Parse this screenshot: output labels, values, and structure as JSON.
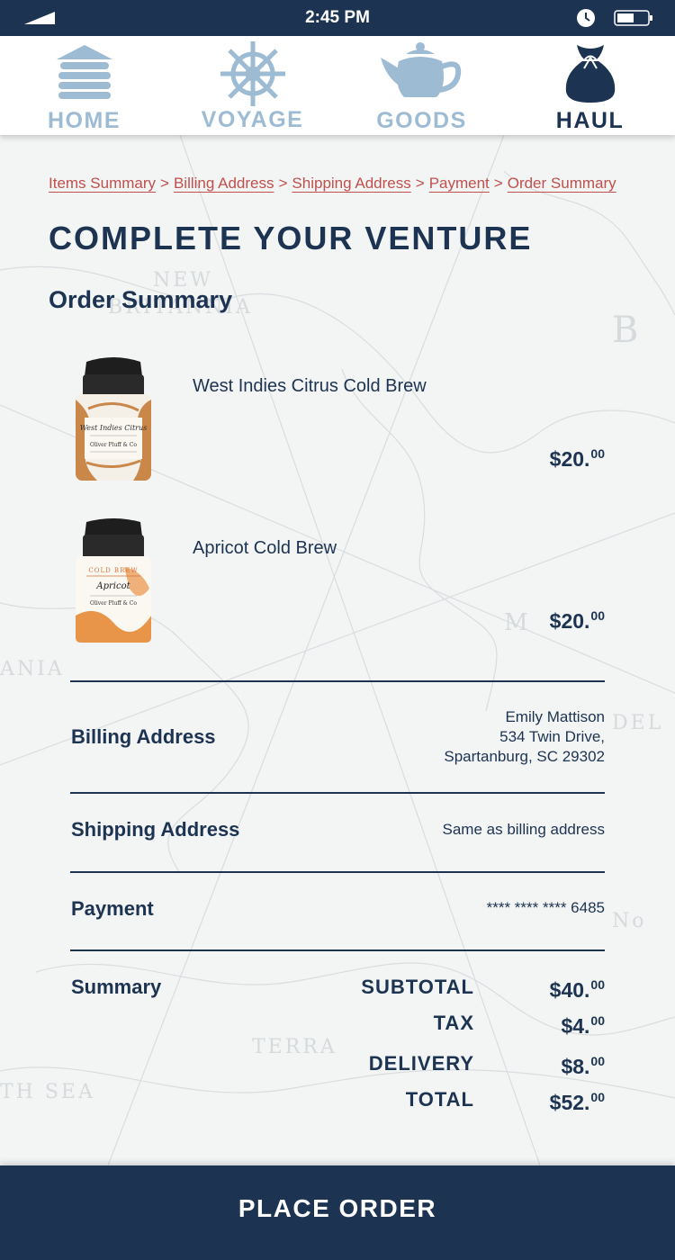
{
  "status_bar": {
    "time": "2:45 PM"
  },
  "nav": {
    "items": [
      {
        "label": "HOME",
        "icon": "cabin-icon",
        "active": false
      },
      {
        "label": "VOYAGE",
        "icon": "ship-wheel-icon",
        "active": false
      },
      {
        "label": "GOODS",
        "icon": "teapot-icon",
        "active": false
      },
      {
        "label": "HAUL",
        "icon": "sack-icon",
        "active": true
      }
    ]
  },
  "breadcrumb": {
    "items": [
      "Items Summary",
      "Billing Address",
      "Shipping Address",
      "Payment",
      "Order Summary"
    ],
    "separator": ">"
  },
  "page_title": "COMPLETE YOUR VENTURE",
  "section_title": "Order Summary",
  "items": [
    {
      "name": "West Indies Citrus Cold Brew",
      "price_main": "$20.",
      "price_cents": "00",
      "tin_label": "West Indies Citrus",
      "tin_brand": "Oliver Pluff & Co"
    },
    {
      "name": "Apricot Cold Brew",
      "price_main": "$20.",
      "price_cents": "00",
      "tin_label": "Apricot",
      "tin_top": "COLD BREW",
      "tin_brand": "Oliver Pluff & Co"
    }
  ],
  "billing": {
    "label": "Billing Address",
    "name": "Emily Mattison",
    "street": "534 Twin Drive,",
    "city": "Spartanburg, SC 29302"
  },
  "shipping": {
    "label": "Shipping Address",
    "value": "Same as billing address"
  },
  "payment": {
    "label": "Payment",
    "value": "**** **** **** 6485"
  },
  "summary": {
    "label": "Summary",
    "lines": [
      {
        "label": "SUBTOTAL",
        "main": "$40.",
        "cents": "00"
      },
      {
        "label": "TAX",
        "main": "$4.",
        "cents": "00"
      },
      {
        "label": "DELIVERY",
        "main": "$8.",
        "cents": "00"
      },
      {
        "label": "TOTAL",
        "main": "$52.",
        "cents": "00"
      }
    ]
  },
  "cta": {
    "label": "PLACE ORDER"
  },
  "colors": {
    "navy": "#1c3351",
    "link_red": "#c0504d",
    "nav_inactive": "#9ebbd4"
  }
}
